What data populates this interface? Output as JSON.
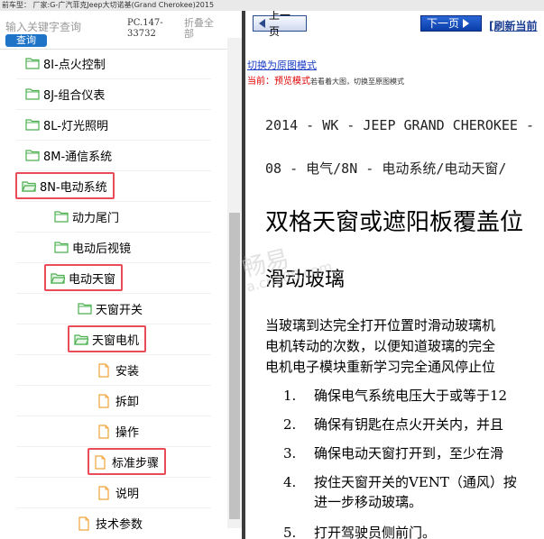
{
  "top_strip": {
    "text": "前车型： 厂家:G-广汽菲克Jeep大切诺基(Grand Cherokee)2015"
  },
  "search": {
    "placeholder": "输入关键字查询",
    "button_label": "查询"
  },
  "pc_code": "PC.147-33732",
  "collapse_all_label": "折叠全部",
  "tree": {
    "items": [
      {
        "label": "8I-点火控制",
        "type": "folder",
        "level": 1,
        "highlighted": false
      },
      {
        "label": "8J-组合仪表",
        "type": "folder",
        "level": 1,
        "highlighted": false
      },
      {
        "label": "8L-灯光照明",
        "type": "folder",
        "level": 1,
        "highlighted": false
      },
      {
        "label": "8M-通信系统",
        "type": "folder",
        "level": 1,
        "highlighted": false
      },
      {
        "label": "8N-电动系统",
        "type": "folder-open",
        "level": 1,
        "highlighted": true
      },
      {
        "label": "动力尾门",
        "type": "folder",
        "level": 2,
        "highlighted": false
      },
      {
        "label": "电动后视镜",
        "type": "folder",
        "level": 2,
        "highlighted": false
      },
      {
        "label": "电动天窗",
        "type": "folder-open",
        "level": 2,
        "highlighted": true
      },
      {
        "label": "天窗开关",
        "type": "folder",
        "level": 3,
        "highlighted": false
      },
      {
        "label": "天窗电机",
        "type": "folder-open",
        "level": 3,
        "highlighted": true
      },
      {
        "label": "安装",
        "type": "document",
        "level": 4,
        "highlighted": false
      },
      {
        "label": "拆卸",
        "type": "document",
        "level": 4,
        "highlighted": false
      },
      {
        "label": "操作",
        "type": "document",
        "level": 4,
        "highlighted": false
      },
      {
        "label": "标准步骤",
        "type": "document",
        "level": 4,
        "highlighted": true
      },
      {
        "label": "说明",
        "type": "document",
        "level": 4,
        "highlighted": false
      },
      {
        "label": "技术参数",
        "type": "document",
        "level": 3,
        "highlighted": false
      }
    ]
  },
  "viewer": {
    "prev_label": "上一页",
    "next_label": "下一页",
    "refresh_label": "[刷新当前",
    "toggle_link": "切换为原图模式",
    "current_prefix": "当前：",
    "current_mode": "预览模式",
    "current_hint": "若看着大图，切换至原图模式"
  },
  "document": {
    "model_line": "2014 - WK - JEEP GRAND CHEROKEE -",
    "section_line": "08 - 电气/8N - 电动系统/电动天窗/",
    "title": "双格天窗或遮阳板覆盖位",
    "subtitle": "滑动玻璃",
    "paragraph": [
      "当玻璃到达完全打开位置时滑动玻璃机",
      "电机转动的次数，以便知道玻璃的完全",
      "电机电子模块重新学习完全通风停止位"
    ],
    "steps": [
      {
        "num": "1.",
        "lines": [
          "确保电气系统电压大于或等于12"
        ]
      },
      {
        "num": "2.",
        "lines": [
          "确保有钥匙在点火开关内，并且"
        ]
      },
      {
        "num": "3.",
        "lines": [
          "确保电动天窗打开到，至少在滑"
        ]
      },
      {
        "num": "4.",
        "lines": [
          "按住天窗开关的VENT（通风）按",
          "进一步移动玻璃。"
        ]
      },
      {
        "num": "5.",
        "lines": [
          "打开驾驶员侧前门。"
        ]
      }
    ]
  },
  "watermark": {
    "brand": "畅易",
    "site": "a.cn388.com"
  },
  "colors": {
    "highlight_border": "#e94b58",
    "folder_green": "#4caf50",
    "doc_orange": "#f0a33a",
    "button_blue": "#1f74c8"
  }
}
